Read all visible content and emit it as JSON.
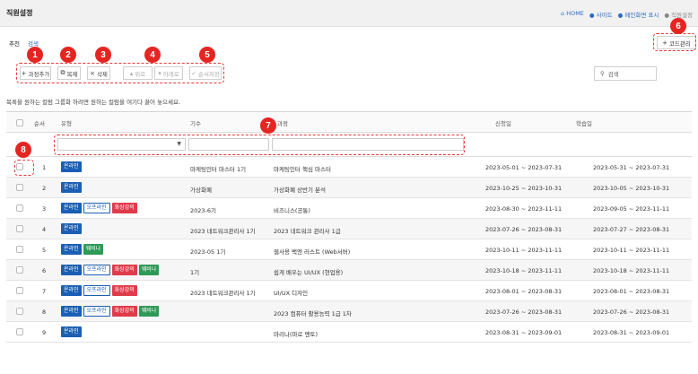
{
  "header": {
    "title": "직원설정",
    "breadcrumb": [
      "HOME",
      "사이트",
      "메인화면 표시",
      "직원설정"
    ]
  },
  "tabs": [
    {
      "label": "추천",
      "active": true
    },
    {
      "label": "검색",
      "active": false
    }
  ],
  "actions": {
    "code_manage": "코드관리",
    "add": "과정추가",
    "copy": "복제",
    "delete": "삭제",
    "up": "위로",
    "down": "아래로",
    "reorder": "순서저장"
  },
  "search": {
    "placeholder": "검색"
  },
  "hint": "목록을 원하는 컬럼 그룹화 하려면 원하는 컬럼을 여기다 끌어 놓으세요.",
  "table": {
    "headers": [
      "순서",
      "유형",
      "기수",
      "과정",
      "신청일",
      "학습일"
    ],
    "rows": [
      {
        "order": "1",
        "badges": [
          "online"
        ],
        "term": "마케팅인터 마스터 1기",
        "course": "마케팅인터 핵심 마스터",
        "apply": "2023-05-01 ~ 2023-07-31",
        "study": "2023-05-31 ~ 2023-07-31"
      },
      {
        "order": "2",
        "badges": [
          "online"
        ],
        "term": "가상화폐",
        "course": "가상화폐 상반기 분석",
        "apply": "2023-10-25 ~ 2023-10-31",
        "study": "2023-10-05 ~ 2023-10-31"
      },
      {
        "order": "3",
        "badges": [
          "online",
          "offline",
          "video"
        ],
        "term": "2023-6기",
        "course": "비즈니스(공통)",
        "apply": "2023-08-30 ~ 2023-11-11",
        "study": "2023-09-05 ~ 2023-11-11"
      },
      {
        "order": "4",
        "badges": [
          "online"
        ],
        "term": "2023 네트워크관리사 1기",
        "course": "2023 네트워크 관리사 1급",
        "apply": "2023-07-26 ~ 2023-08-31",
        "study": "2023-07-27 ~ 2023-08-31"
      },
      {
        "order": "5",
        "badges": [
          "online",
          "webinar"
        ],
        "term": "2023-05 1기",
        "course": "웹사용 백엔 러스트 (Web서버)",
        "apply": "2023-10-11 ~ 2023-11-11",
        "study": "2023-10-11 ~ 2023-11-11"
      },
      {
        "order": "6",
        "badges": [
          "online",
          "offline",
          "video",
          "webinar"
        ],
        "term": "1기",
        "course": "쉽게 배우는 UI/UX (현업용)",
        "apply": "2023-10-18 ~ 2023-11-11",
        "study": "2023-10-18 ~ 2023-11-11"
      },
      {
        "order": "7",
        "badges": [
          "online",
          "offline",
          "video"
        ],
        "term": "2023 네트워크관리사 1기",
        "course": "UI/UX 디자인",
        "apply": "2023-08-01 ~ 2023-08-31",
        "study": "2023-08-01 ~ 2023-08-31"
      },
      {
        "order": "8",
        "badges": [
          "online",
          "offline",
          "video",
          "webinar"
        ],
        "term": "",
        "course": "2023 컴퓨터 활용능력 1급 1차",
        "apply": "2023-07-26 ~ 2023-08-31",
        "study": "2023-07-26 ~ 2023-08-31"
      },
      {
        "order": "9",
        "badges": [
          "online"
        ],
        "term": "",
        "course": "마리나(마로 멘토)",
        "apply": "2023-08-31 ~ 2023-09-01",
        "study": "2023-08-31 ~ 2023-09-01"
      }
    ]
  },
  "badge_labels": {
    "online": "온라인",
    "offline": "오프라인",
    "video": "화상강의",
    "webinar": "웨비나"
  },
  "markers": [
    "1",
    "2",
    "3",
    "4",
    "5",
    "6",
    "7",
    "8"
  ]
}
